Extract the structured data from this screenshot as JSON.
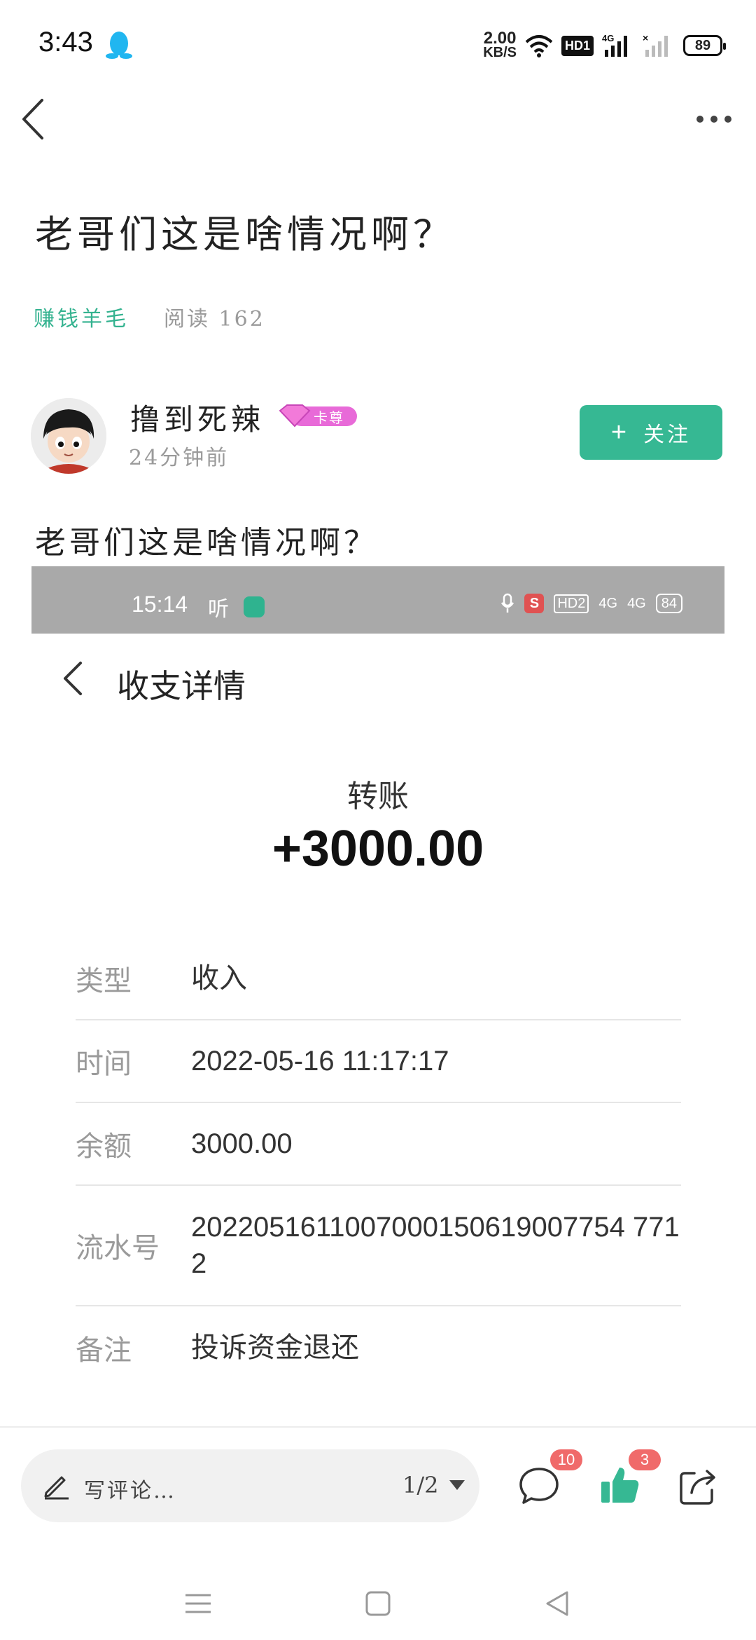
{
  "status_bar": {
    "time": "3:43",
    "speed_value": "2.00",
    "speed_unit": "KB/S",
    "hd_label": "HD1",
    "network_label": "4G",
    "battery": "89"
  },
  "post": {
    "title": "老哥们这是啥情况啊？",
    "category": "赚钱羊毛",
    "reads": "阅读 162",
    "body": "老哥们这是啥情况啊？"
  },
  "author": {
    "name": "撸到死辣",
    "badge_label": "卡尊",
    "time": "24分钟前",
    "follow_label": "关注"
  },
  "screenshot": {
    "status": {
      "time": "15:14",
      "app_glyph": "听",
      "hd": "HD2",
      "net1": "4G",
      "net2": "4G",
      "battery": "84",
      "s_label": "S"
    },
    "title": "收支详情",
    "kind": "转账",
    "amount": "+3000.00",
    "rows": [
      {
        "label": "类型",
        "value": "收入"
      },
      {
        "label": "时间",
        "value": "2022-05-16 11:17:17"
      },
      {
        "label": "余额",
        "value": "3000.00"
      },
      {
        "label": "流水号",
        "value": "2022051611007000150619007754 7712"
      },
      {
        "label": "备注",
        "value": "投诉资金退还"
      }
    ]
  },
  "bottom_bar": {
    "comment_placeholder": "写评论…",
    "page_indicator": "1/2",
    "comment_count": "10",
    "like_count": "3"
  },
  "colors": {
    "accent": "#36b893",
    "badge_red": "#f06a6a",
    "muted": "#9a9a9a"
  }
}
